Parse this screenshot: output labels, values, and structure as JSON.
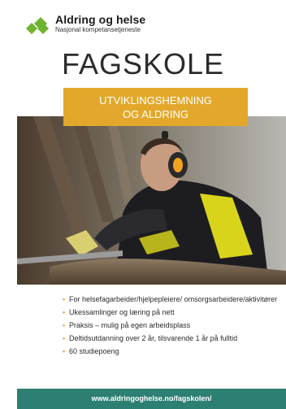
{
  "logo": {
    "title": "Aldring og helse",
    "subtitle": "Nasjonal kompetansetjeneste",
    "colors": {
      "green": "#6fb32e",
      "teal": "#2e7f73"
    }
  },
  "document": {
    "title": "FAGSKOLE",
    "subtitle_line1": "UTVIKLINGSHEMNING",
    "subtitle_line2": "OG ALDRING",
    "accent_color": "#e3a82b"
  },
  "bullets": [
    "For helsefagarbeider/hjelpepleiere/ omsorgsarbeidere/aktivitører",
    "Ukessamlinger og læring på nett",
    "Praksis – mulig på egen arbeidsplass",
    "Deltidsutdanning over 2 år, tilsvarende 1 år på fulltid",
    "60 studiepoeng"
  ],
  "footer": {
    "url": "www.aldringoghelse.no/fagskolen/",
    "color": "#2e7f73"
  }
}
